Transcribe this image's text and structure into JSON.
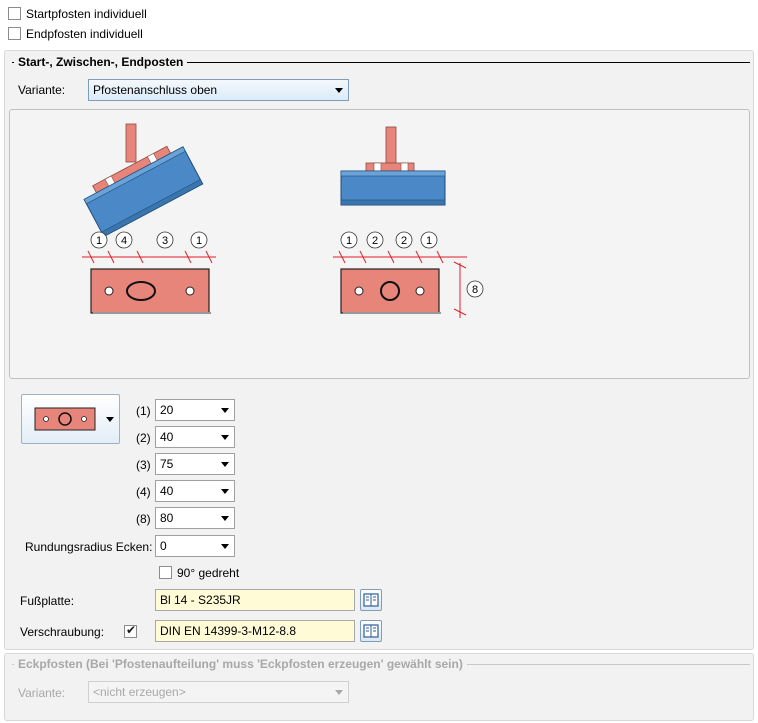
{
  "top": {
    "start_individual": {
      "label": "Startpfosten individuell",
      "checked": false
    },
    "end_individual": {
      "label": "Endpfosten individuell",
      "checked": false
    }
  },
  "section1": {
    "title": "Start-, Zwischen-, Endposten",
    "variant_label": "Variante:",
    "variant_value": "Pfostenanschluss oben",
    "diagram": {
      "left_dims": [
        "1",
        "4",
        "3",
        "1"
      ],
      "right_dims": [
        "1",
        "2",
        "2",
        "1"
      ],
      "height_dim": "8"
    },
    "params": [
      {
        "label": "(1)",
        "value": "20"
      },
      {
        "label": "(2)",
        "value": "40"
      },
      {
        "label": "(3)",
        "value": "75"
      },
      {
        "label": "(4)",
        "value": "40"
      },
      {
        "label": "(8)",
        "value": "80"
      }
    ],
    "corner_radius_label": "Rundungsradius Ecken:",
    "corner_radius_value": "0",
    "rotated": {
      "label": "90° gedreht",
      "checked": false
    },
    "base_plate_label": "Fußplatte:",
    "base_plate_value": "Bl 14 - S235JR",
    "bolting_label": "Verschraubung:",
    "bolting_checked": true,
    "bolting_value": "DIN EN 14399-3-M12-8.8"
  },
  "section2": {
    "title": "Eckpfosten (Bei 'Pfostenaufteilung' muss 'Eckpfosten erzeugen' gewählt sein)",
    "variant_label": "Variante:",
    "variant_value": "<nicht erzeugen>"
  },
  "colors": {
    "plate": "#e8857a",
    "beam": "#4a88c7",
    "dimension": "#e0202a"
  }
}
